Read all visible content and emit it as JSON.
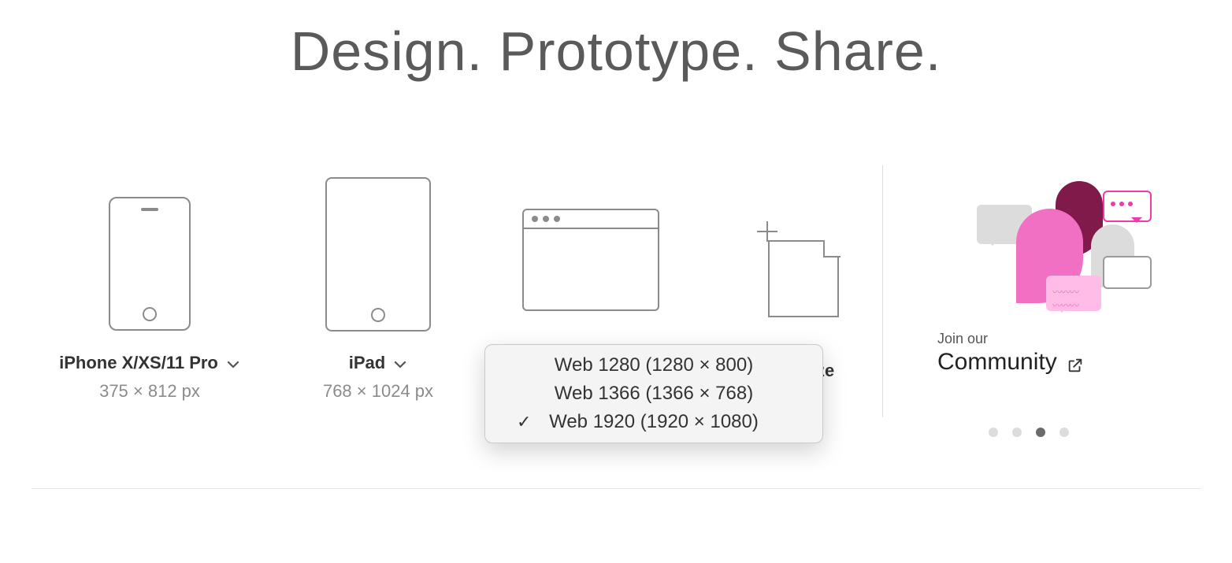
{
  "headline": "Design. Prototype. Share.",
  "presets": {
    "phone": {
      "label": "iPhone X/XS/11 Pro",
      "dimensions": "375 × 812 px"
    },
    "tablet": {
      "label": "iPad",
      "dimensions": "768 × 1024 px"
    },
    "custom_label_fragment": "ze"
  },
  "web_dropdown": {
    "items": [
      {
        "label": "Web 1280 (1280 × 800)",
        "checked": false
      },
      {
        "label": "Web 1366 (1366 × 768)",
        "checked": false
      },
      {
        "label": "Web 1920 (1920 × 1080)",
        "checked": true
      }
    ]
  },
  "aside": {
    "join_label": "Join our",
    "community_label": "Community"
  },
  "pager": {
    "count": 4,
    "active_index": 2
  }
}
